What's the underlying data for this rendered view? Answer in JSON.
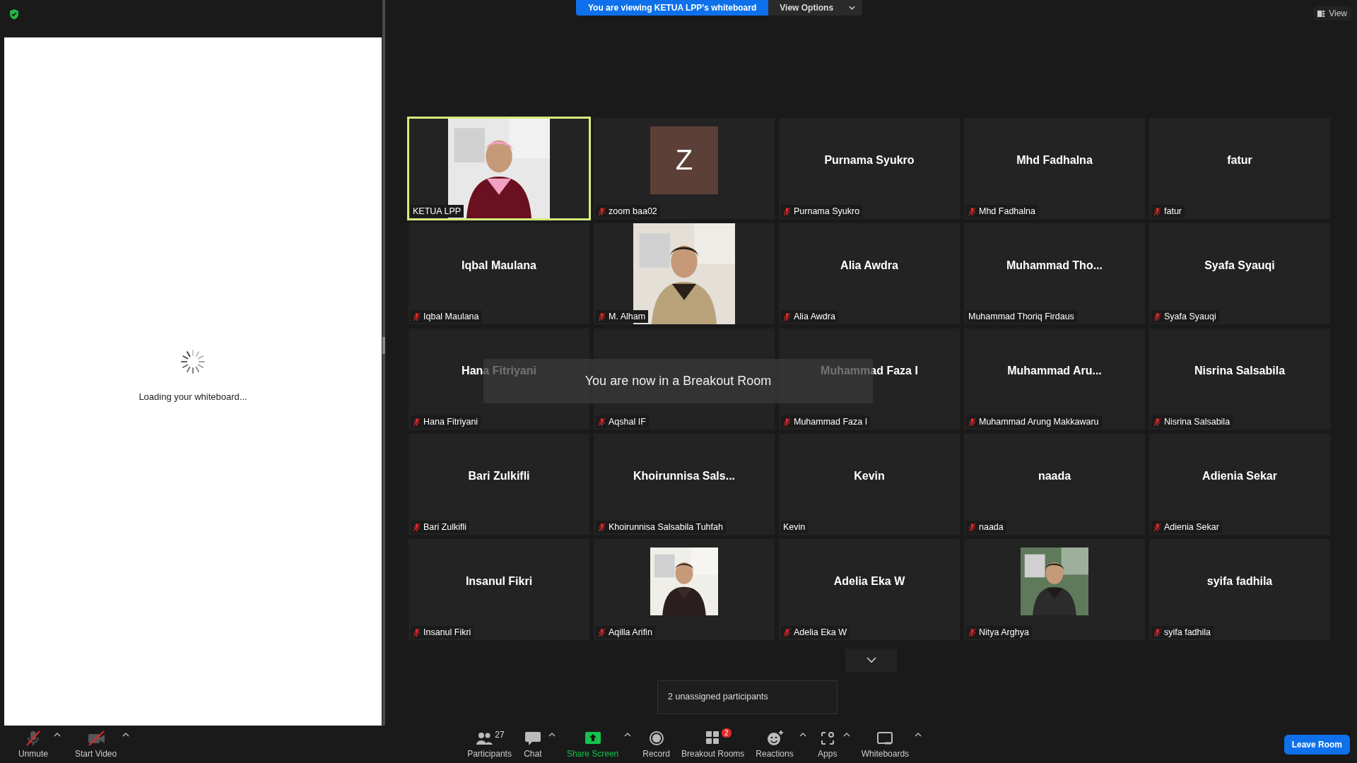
{
  "whiteboard": {
    "loading_text": "Loading your whiteboard..."
  },
  "banner": {
    "message": "You are viewing KETUA LPP’s whiteboard",
    "view_options": "View Options"
  },
  "view_button": "View",
  "tiles": [
    {
      "kind": "video",
      "label": "KETUA LPP",
      "muted": false,
      "active_speaker": true
    },
    {
      "kind": "avatar",
      "initial": "Z",
      "label": "zoom baa02",
      "muted": true,
      "active_speaker": false
    },
    {
      "kind": "name",
      "name": "Purnama Syukro",
      "label": "Purnama Syukro",
      "muted": true,
      "active_speaker": false
    },
    {
      "kind": "name",
      "name": "Mhd Fadhalna",
      "label": "Mhd Fadhalna",
      "muted": true,
      "active_speaker": false
    },
    {
      "kind": "name",
      "name": "fatur",
      "label": "fatur",
      "muted": true,
      "active_speaker": false
    },
    {
      "kind": "name",
      "name": "Iqbal Maulana",
      "label": "Iqbal Maulana",
      "muted": true,
      "active_speaker": false
    },
    {
      "kind": "video",
      "label": "M. Alham",
      "muted": true,
      "active_speaker": false
    },
    {
      "kind": "name",
      "name": "Alia Awdra",
      "label": "Alia Awdra",
      "muted": true,
      "active_speaker": false
    },
    {
      "kind": "name",
      "name": "Muhammad  Tho...",
      "label": "Muhammad Thoriq Firdaus",
      "muted": false,
      "active_speaker": false
    },
    {
      "kind": "name",
      "name": "Syafa Syauqi",
      "label": "Syafa Syauqi",
      "muted": true,
      "active_speaker": false
    },
    {
      "kind": "name",
      "name": "Hana Fitriyani",
      "label": "Hana Fitriyani",
      "muted": true,
      "active_speaker": false
    },
    {
      "kind": "blank",
      "label": "Aqshal IF",
      "muted": true,
      "active_speaker": false
    },
    {
      "kind": "name",
      "name": "Muhammad Faza I",
      "label": "Muhammad Faza I",
      "muted": true,
      "active_speaker": false
    },
    {
      "kind": "name",
      "name": "Muhammad  Aru...",
      "label": "Muhammad Arung Makkawaru",
      "muted": true,
      "active_speaker": false
    },
    {
      "kind": "name",
      "name": "Nisrina Salsabila",
      "label": "Nisrina Salsabila",
      "muted": true,
      "active_speaker": false
    },
    {
      "kind": "name",
      "name": "Bari Zulkifli",
      "label": "Bari Zulkifli",
      "muted": true,
      "active_speaker": false
    },
    {
      "kind": "name",
      "name": "Khoirunnisa  Sals...",
      "label": "Khoirunnisa Salsabila Tuhfah",
      "muted": true,
      "active_speaker": false
    },
    {
      "kind": "name",
      "name": "Kevin",
      "label": "Kevin",
      "muted": false,
      "active_speaker": false
    },
    {
      "kind": "name",
      "name": "naada",
      "label": "naada",
      "muted": true,
      "active_speaker": false
    },
    {
      "kind": "name",
      "name": "Adienia Sekar",
      "label": "Adienia Sekar",
      "muted": true,
      "active_speaker": false
    },
    {
      "kind": "name",
      "name": "Insanul Fikri",
      "label": "Insanul Fikri",
      "muted": true,
      "active_speaker": false
    },
    {
      "kind": "picture",
      "label": "Aqilla Arifin",
      "muted": true,
      "active_speaker": false
    },
    {
      "kind": "name",
      "name": "Adelia Eka W",
      "label": "Adelia Eka W",
      "muted": true,
      "active_speaker": false
    },
    {
      "kind": "picture",
      "label": "Nitya Arghya",
      "muted": true,
      "active_speaker": false
    },
    {
      "kind": "name",
      "name": "syifa fadhila",
      "label": "syifa fadhila",
      "muted": true,
      "active_speaker": false
    }
  ],
  "toast": "You are now in a Breakout Room",
  "tooltip": "2 unassigned participants",
  "toolbar": {
    "left": [
      {
        "kind": "unmute",
        "label": "Unmute",
        "caret": true
      },
      {
        "kind": "video",
        "label": "Start Video",
        "caret": true
      }
    ],
    "center": [
      {
        "kind": "participants",
        "label": "Participants",
        "count": "27",
        "caret": false
      },
      {
        "kind": "chat",
        "label": "Chat",
        "caret": true
      },
      {
        "kind": "share",
        "label": "Share Screen",
        "caret": true
      },
      {
        "kind": "record",
        "label": "Record",
        "caret": false
      },
      {
        "kind": "breakout",
        "label": "Breakout Rooms",
        "badge": "2",
        "caret": false
      },
      {
        "kind": "reactions",
        "label": "Reactions",
        "caret": true
      },
      {
        "kind": "apps",
        "label": "Apps",
        "caret": true
      },
      {
        "kind": "whiteboards",
        "label": "Whiteboards",
        "caret": true
      }
    ],
    "leave": "Leave Room"
  }
}
